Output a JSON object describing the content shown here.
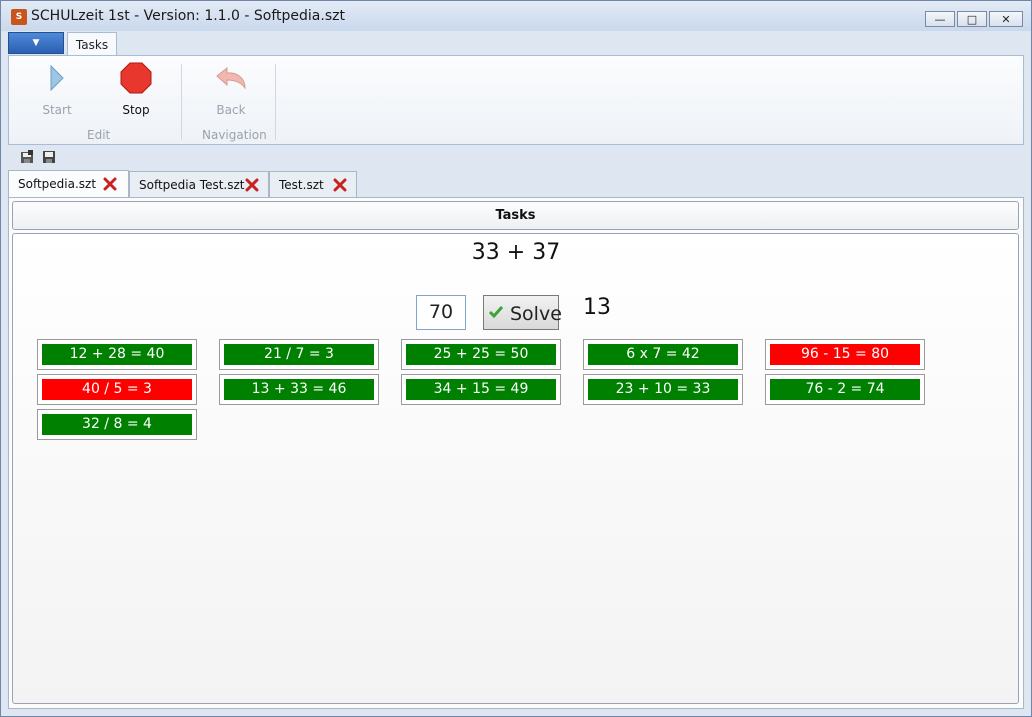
{
  "window": {
    "title": "SCHULzeit 1st - Version: 1.1.0 - Softpedia.szt",
    "icon_text": "S",
    "buttons": [
      "minimize",
      "maximize",
      "close"
    ]
  },
  "ribbon": {
    "tab": "Tasks",
    "groups": [
      {
        "label": "Edit",
        "buttons": [
          {
            "label": "Start",
            "icon": "play-icon"
          },
          {
            "label": "Stop",
            "icon": "stop-icon"
          }
        ]
      },
      {
        "label": "Navigation",
        "buttons": [
          {
            "label": "Back",
            "icon": "back-arrow-icon"
          }
        ]
      }
    ]
  },
  "doc_tabs": [
    {
      "label": "Softpedia.szt",
      "active": true
    },
    {
      "label": "Softpedia Test.szt",
      "active": false
    },
    {
      "label": "Test.szt",
      "active": false
    }
  ],
  "tasks": {
    "header": "Tasks",
    "question": "33 + 37",
    "answer_value": "70",
    "solve_label": "Solve",
    "counter": "13",
    "results": [
      {
        "text": "12 + 28 = 40",
        "correct": true
      },
      {
        "text": "21 / 7 = 3",
        "correct": true
      },
      {
        "text": "25 + 25 = 50",
        "correct": true
      },
      {
        "text": "6 x 7 = 42",
        "correct": true
      },
      {
        "text": "96 - 15 = 80",
        "correct": false
      },
      {
        "text": "40 / 5 = 3",
        "correct": false
      },
      {
        "text": "13 + 33 = 46",
        "correct": true
      },
      {
        "text": "34 + 15 = 49",
        "correct": true
      },
      {
        "text": "23 + 10 = 33",
        "correct": true
      },
      {
        "text": "76 - 2 = 74",
        "correct": true
      },
      {
        "text": "32 / 8 = 4",
        "correct": true
      }
    ]
  },
  "colors": {
    "correct": "#008000",
    "wrong": "#ff0000"
  }
}
